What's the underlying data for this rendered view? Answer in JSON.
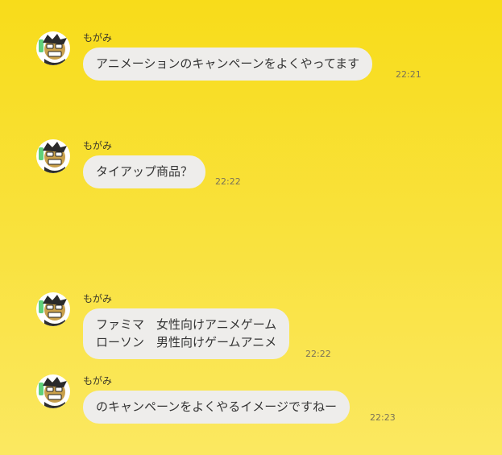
{
  "messages": [
    {
      "sender": "もがみ",
      "lines": [
        "アニメーションのキャンペーンをよくやってます"
      ],
      "time": "22:21"
    },
    {
      "sender": "もがみ",
      "lines": [
        "タイアップ商品？"
      ],
      "time": "22:22"
    },
    {
      "sender": "もがみ",
      "lines": [
        "ファミマ　女性向けアニメゲーム",
        "ローソン　男性向けゲームアニメ"
      ],
      "time": "22:22"
    },
    {
      "sender": "もがみ",
      "lines": [
        "のキャンペーンをよくやるイメージですねー"
      ],
      "time": "22:23"
    }
  ],
  "avatar_icon": "cartoon-face-icon",
  "colors": {
    "background_top": "#f8dc1a",
    "background_bottom": "#fbe861",
    "bubble": "#eeedeb",
    "text": "#333333",
    "time": "#7a7258"
  }
}
